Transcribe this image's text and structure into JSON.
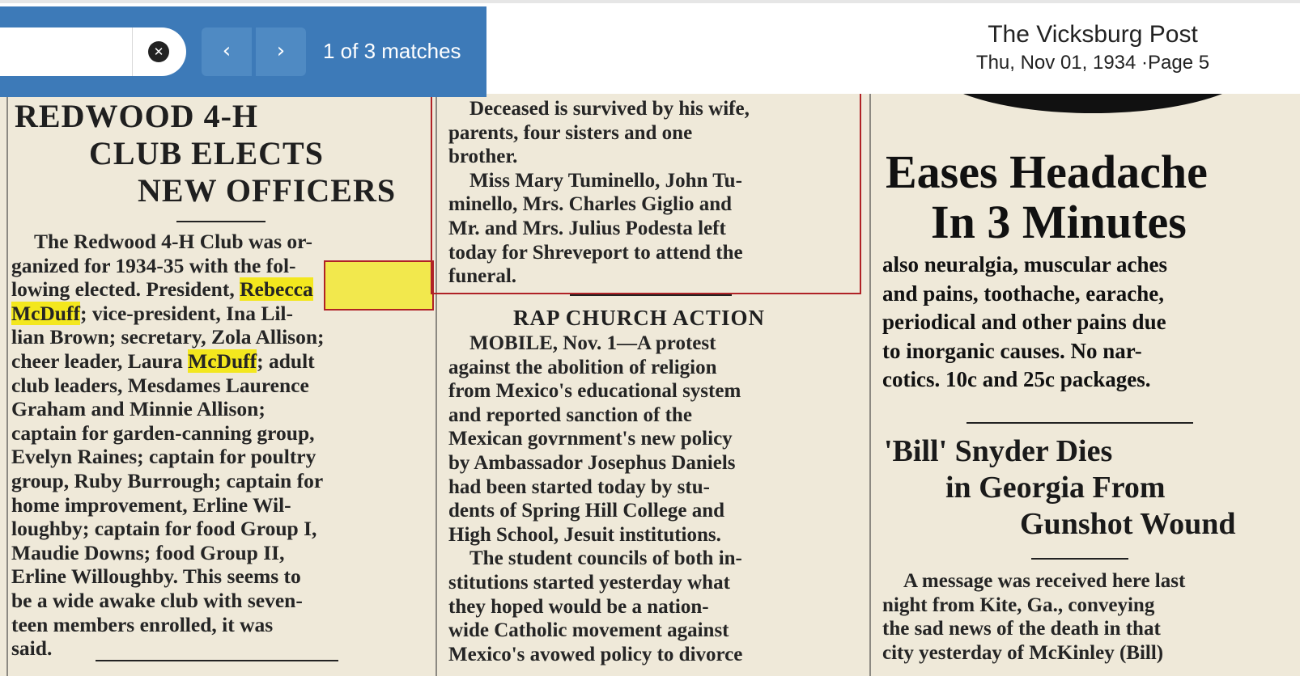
{
  "toolbar": {
    "search_value": "",
    "clear_label": "✕",
    "prev_label": "‹",
    "next_label": "›",
    "match_count": "1 of 3 matches"
  },
  "paper": {
    "title": "The Vicksburg Post",
    "date_page": "Thu, Nov 01, 1934 ·Page 5"
  },
  "article_left": {
    "headline": [
      "REDWOOD 4-H",
      "CLUB ELECTS",
      "NEW OFFICERS"
    ],
    "lines": [
      "The Redwood 4-H Club was or-",
      "ganized for 1934-35 with the fol-",
      "lowing elected. President, Rebecca",
      "McDuff; vice-president, Ina Lil-",
      "lian Brown; secretary, Zola Allison;",
      "cheer leader, Laura McDuff; adult",
      "club leaders, Mesdames Laurence",
      "Graham and Minnie Allison;",
      "captain for garden-canning group,",
      "Evelyn Raines; captain for poultry",
      "group, Ruby Burrough; captain for",
      "home improvement, Erline Wil-",
      "loughby; captain for food Group I,",
      "Maudie Downs; food Group II,",
      "Erline Willoughby. This seems to",
      "be a wide awake club with seven-",
      "teen members enrolled, it was",
      "said."
    ],
    "highlights": {
      "rebecca": "Rebecca",
      "mcduff1": "McDuff",
      "mcduff2": "McDuff"
    }
  },
  "article_middle_top": {
    "lines": [
      "Deceased is survived by his wife,",
      "parents, four sisters and one",
      "brother.",
      "Miss Mary Tuminello, John Tu-",
      "minello, Mrs. Charles Giglio and",
      "Mr. and Mrs. Julius Podesta left",
      "today for Shreveport to attend the",
      "funeral."
    ]
  },
  "article_middle": {
    "headline": "RAP CHURCH ACTION",
    "lines": [
      "MOBILE, Nov. 1—A protest",
      "against the abolition of religion",
      "from Mexico's educational system",
      "and reported sanction of the",
      "Mexican govrnment's new policy",
      "by Ambassador Josephus Daniels",
      "had been started today by stu-",
      "dents of Spring Hill College and",
      "High School, Jesuit institutions.",
      "The student councils of both in-",
      "stitutions started yesterday what",
      "they hoped would be a nation-",
      "wide Catholic movement against",
      "Mexico's avowed policy to divorce"
    ]
  },
  "ad_right": {
    "headline": [
      "Eases Headache",
      "In 3 Minutes"
    ],
    "lines": [
      "also neuralgia, muscular aches",
      "and pains, toothache, earache,",
      "periodical and other pains due",
      "to inorganic causes. No nar-",
      "cotics. 10c and 25c packages."
    ]
  },
  "article_right": {
    "headline": [
      "'Bill' Snyder Dies",
      "in Georgia From",
      "Gunshot Wound"
    ],
    "lines": [
      "A message was received here last",
      "night from Kite, Ga., conveying",
      "the sad news of the death in that",
      "city yesterday of McKinley (Bill)"
    ]
  }
}
